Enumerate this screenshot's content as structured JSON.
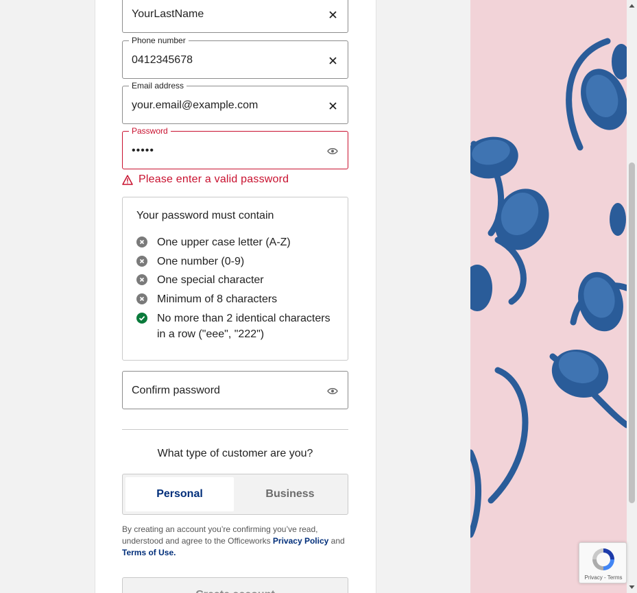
{
  "form": {
    "last_name": {
      "value": "YourLastName"
    },
    "phone": {
      "label": "Phone number",
      "value": "0412345678"
    },
    "email": {
      "label": "Email address",
      "value": "your.email@example.com"
    },
    "password": {
      "label": "Password",
      "value": "•••••"
    },
    "password_error": "Please enter a valid password",
    "confirm_password": {
      "placeholder": "Confirm password"
    }
  },
  "password_rules": {
    "title": "Your password must contain",
    "items": [
      {
        "text": "One upper case letter (A-Z)",
        "status": "unmet"
      },
      {
        "text": "One number (0-9)",
        "status": "unmet"
      },
      {
        "text": "One special character",
        "status": "unmet"
      },
      {
        "text": "Minimum of 8 characters",
        "status": "unmet"
      },
      {
        "text": "No more than 2 identical characters in a row (\"eee\", \"222\")",
        "status": "met"
      }
    ]
  },
  "customer_type": {
    "question": "What type of customer are you?",
    "options": [
      "Personal",
      "Business"
    ],
    "selected": "Personal"
  },
  "legal": {
    "prefix": "By creating an account you’re confirming you’ve read, understood and agree to the Officeworks ",
    "privacy_link": "Privacy Policy",
    "middle": " and",
    "terms_link": "Terms of Use."
  },
  "create_button": {
    "label": "Create account"
  },
  "recaptcha": {
    "text": "Privacy - Terms"
  },
  "colors": {
    "error": "#c8102e",
    "brand_navy": "#002e7a",
    "success": "#0a7a3b",
    "unmet_icon": "#7a7a7a",
    "hero_bg": "#f2d3d8",
    "headphone_blue": "#2a5c99"
  },
  "icons": {
    "clear": "close-icon",
    "reveal": "eye-icon",
    "warning": "warning-triangle-icon",
    "rule_unmet": "x-circle-icon",
    "rule_met": "check-circle-icon"
  }
}
